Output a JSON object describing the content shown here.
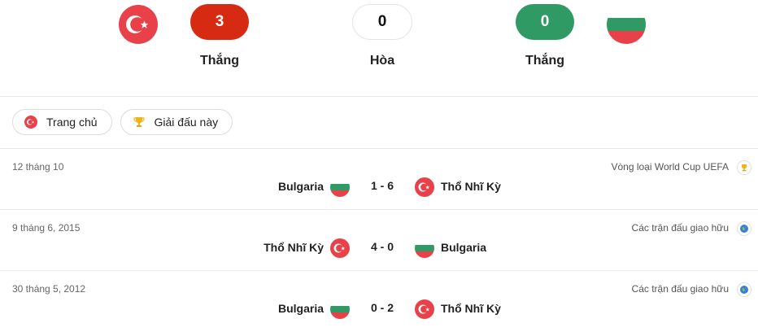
{
  "summary": {
    "home_wins": "3",
    "draws": "0",
    "away_wins": "0",
    "home_label": "Thắng",
    "draw_label": "Hòa",
    "away_label": "Thắng"
  },
  "filters": [
    {
      "label": "Trang chủ",
      "icon": "turkey-flag-icon"
    },
    {
      "label": "Giải đấu này",
      "icon": "trophy-icon"
    }
  ],
  "matches": [
    {
      "date": "12 tháng 10",
      "competition": "Vòng loại World Cup UEFA",
      "competition_icon": "trophy-icon",
      "home": "Bulgaria",
      "score": "1 - 6",
      "away": "Thổ Nhĩ Kỳ"
    },
    {
      "date": "9 tháng 6, 2015",
      "competition": "Các trận đấu giao hữu",
      "competition_icon": "globe-icon",
      "home": "Thổ Nhĩ Kỳ",
      "score": "4 - 0",
      "away": "Bulgaria"
    },
    {
      "date": "30 tháng 5, 2012",
      "competition": "Các trận đấu giao hữu",
      "competition_icon": "globe-icon",
      "home": "Bulgaria",
      "score": "0 - 2",
      "away": "Thổ Nhĩ Kỳ"
    }
  ],
  "colors": {
    "win_red": "#d62a12",
    "win_green": "#2f9a63",
    "turkey_red": "#e30a17",
    "bulgaria_green": "#00966e",
    "bulgaria_red": "#d62612"
  }
}
